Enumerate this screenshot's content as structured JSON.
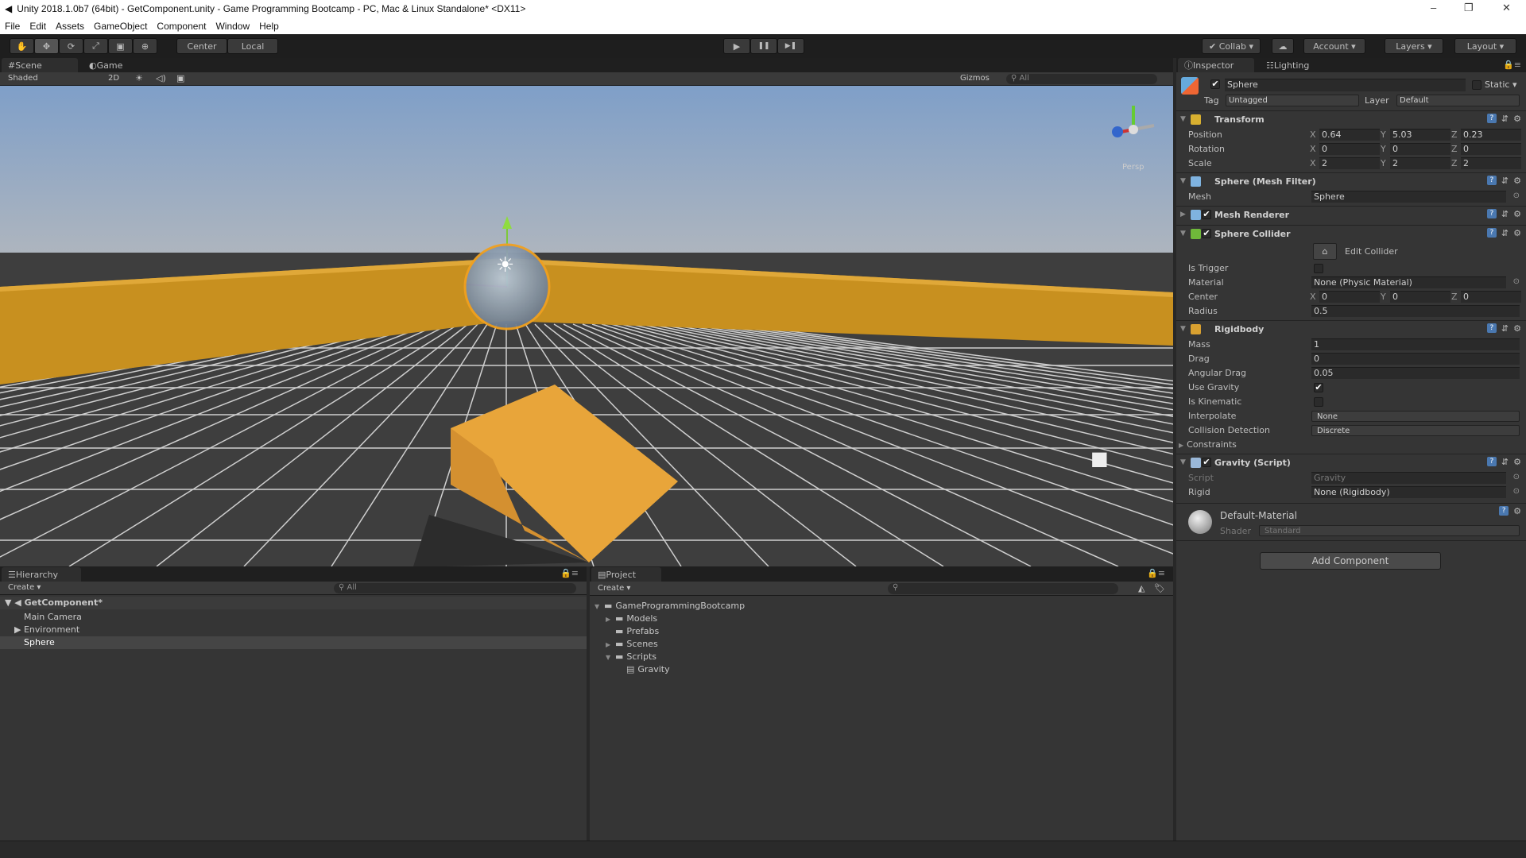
{
  "window": {
    "title": "Unity 2018.1.0b7 (64bit) - GetComponent.unity - Game Programming Bootcamp - PC, Mac & Linux Standalone* <DX11>",
    "controls": [
      "–",
      "❐",
      "✕"
    ]
  },
  "menu": [
    "File",
    "Edit",
    "Assets",
    "GameObject",
    "Component",
    "Window",
    "Help"
  ],
  "toolbar": {
    "tools": [
      "✋",
      "✥",
      "⟳",
      "⤢",
      "▣",
      "⊕"
    ],
    "pivot": "Center",
    "space": "Local",
    "play": "▶",
    "pause": "❚❚",
    "step": "▶❚",
    "collab": "Collab",
    "account": "Account",
    "layers": "Layers",
    "layout": "Layout"
  },
  "scene": {
    "tabs": [
      "Scene",
      "Game"
    ],
    "shading": "Shaded",
    "mode_2d": "2D",
    "gizmos": "Gizmos",
    "search": "All",
    "gizmo_label": "Persp",
    "colors": {
      "wall": "#c8901f",
      "ramp": "#e8a53a",
      "floor": "#3e3e3e"
    }
  },
  "inspector": {
    "tabs": [
      "Inspector",
      "Lighting"
    ],
    "object": {
      "name": "Sphere",
      "active": true,
      "static_label": "Static",
      "tag_label": "Tag",
      "tag": "Untagged",
      "layer_label": "Layer",
      "layer": "Default"
    },
    "components": [
      {
        "title": "Transform",
        "icon": "transform-icon",
        "color": "#d8b030",
        "checkbox": false,
        "rows": [
          {
            "type": "vec3",
            "label": "Position",
            "values": [
              "0.64",
              "5.03",
              "0.23"
            ]
          },
          {
            "type": "vec3",
            "label": "Rotation",
            "values": [
              "0",
              "0",
              "0"
            ]
          },
          {
            "type": "vec3",
            "label": "Scale",
            "values": [
              "2",
              "2",
              "2"
            ]
          }
        ]
      },
      {
        "title": "Sphere (Mesh Filter)",
        "icon": "mesh-filter-icon",
        "color": "#7fb3e0",
        "checkbox": false,
        "rows": [
          {
            "type": "object",
            "label": "Mesh",
            "value": "Sphere"
          }
        ]
      },
      {
        "title": "Mesh Renderer",
        "icon": "mesh-renderer-icon",
        "color": "#7fb3e0",
        "checkbox": true,
        "collapsed": true,
        "rows": []
      },
      {
        "title": "Sphere Collider",
        "icon": "sphere-collider-icon",
        "color": "#6fb83a",
        "checkbox": true,
        "rows": [
          {
            "type": "button",
            "label": "Edit Collider"
          },
          {
            "type": "check",
            "label": "Is Trigger",
            "value": false
          },
          {
            "type": "object",
            "label": "Material",
            "value": "None (Physic Material)"
          },
          {
            "type": "vec3",
            "label": "Center",
            "values": [
              "0",
              "0",
              "0"
            ]
          },
          {
            "type": "text",
            "label": "Radius",
            "value": "0.5"
          }
        ]
      },
      {
        "title": "Rigidbody",
        "icon": "rigidbody-icon",
        "color": "#d8a030",
        "checkbox": false,
        "rows": [
          {
            "type": "text",
            "label": "Mass",
            "value": "1"
          },
          {
            "type": "text",
            "label": "Drag",
            "value": "0"
          },
          {
            "type": "text",
            "label": "Angular Drag",
            "value": "0.05"
          },
          {
            "type": "check",
            "label": "Use Gravity",
            "value": true
          },
          {
            "type": "check",
            "label": "Is Kinematic",
            "value": false
          },
          {
            "type": "dropdown",
            "label": "Interpolate",
            "value": "None"
          },
          {
            "type": "dropdown",
            "label": "Collision Detection",
            "value": "Discrete"
          },
          {
            "type": "foldout",
            "label": "Constraints"
          }
        ]
      },
      {
        "title": "Gravity (Script)",
        "icon": "csharp-script-icon",
        "color": "#9ab8d8",
        "checkbox": true,
        "rows": [
          {
            "type": "object",
            "label": "Script",
            "value": "Gravity",
            "disabled": true
          },
          {
            "type": "object",
            "label": "Rigid",
            "value": "None (Rigidbody)"
          }
        ]
      }
    ],
    "axes": [
      "X",
      "Y",
      "Z"
    ],
    "material": {
      "name": "Default-Material",
      "shader_label": "Shader",
      "shader": "Standard"
    },
    "add_component": "Add Component"
  },
  "hierarchy": {
    "tab": "Hierarchy",
    "create": "Create",
    "search": "All",
    "scene": "GetComponent*",
    "items": [
      "Main Camera",
      "Environment",
      "Sphere"
    ],
    "selected": "Sphere"
  },
  "project": {
    "tab": "Project",
    "create": "Create",
    "tree": [
      {
        "name": "GameProgrammingBootcamp",
        "depth": 0,
        "arrow": "▼"
      },
      {
        "name": "Models",
        "depth": 1,
        "arrow": "▶"
      },
      {
        "name": "Prefabs",
        "depth": 1,
        "arrow": ""
      },
      {
        "name": "Scenes",
        "depth": 1,
        "arrow": "▶"
      },
      {
        "name": "Scripts",
        "depth": 1,
        "arrow": "▼"
      },
      {
        "name": "Gravity",
        "depth": 2,
        "arrow": "",
        "file": true
      }
    ]
  }
}
